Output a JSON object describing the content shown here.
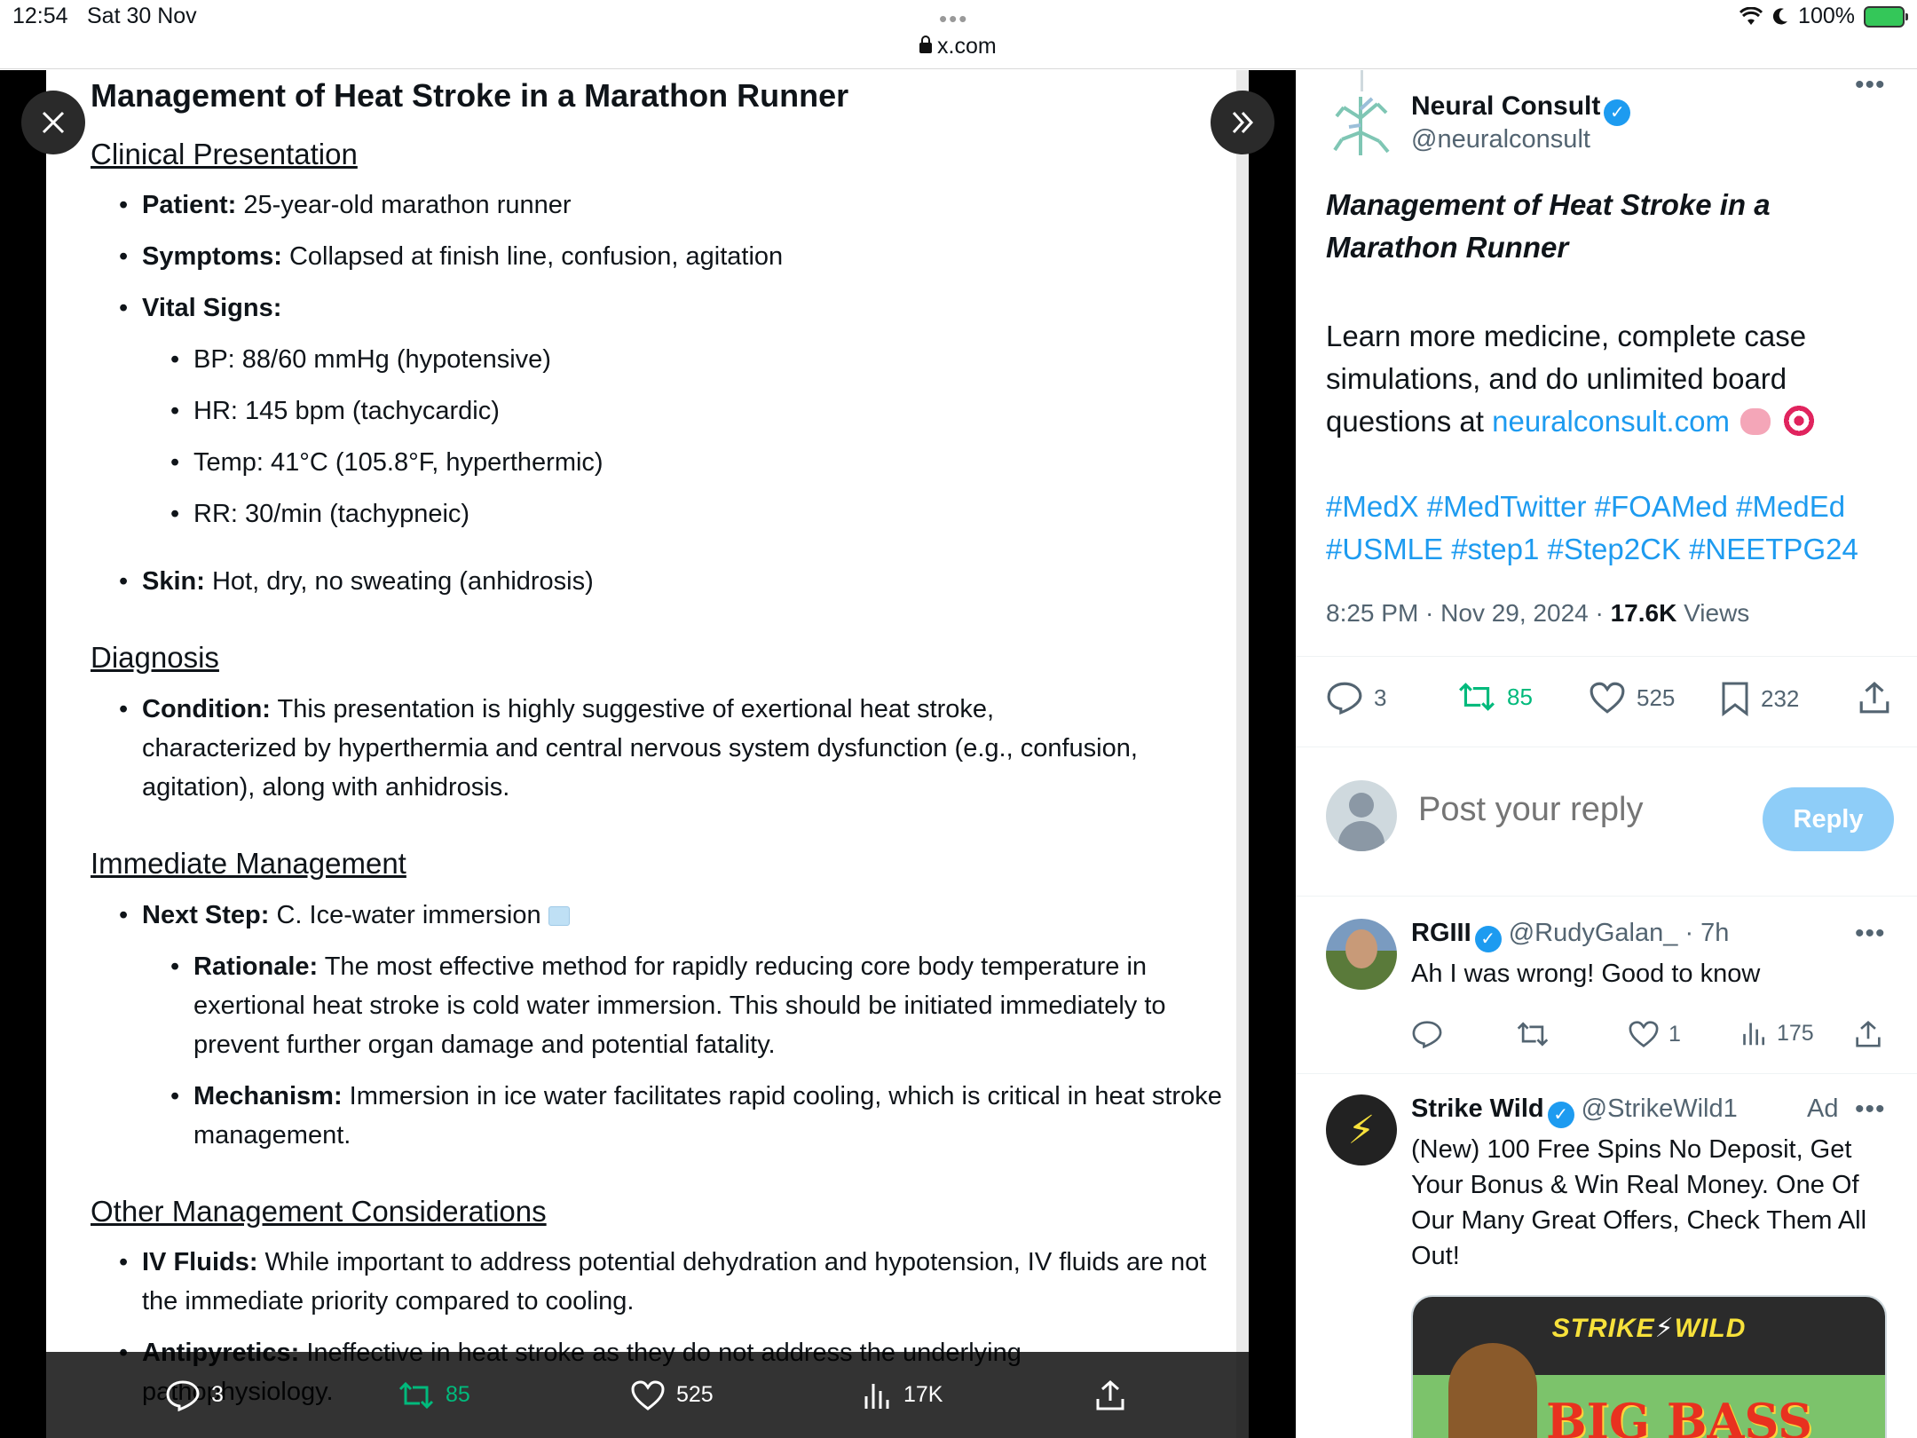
{
  "status_bar": {
    "time": "12:54",
    "date": "Sat 30 Nov",
    "url": "x.com",
    "battery": "100%"
  },
  "document": {
    "title": "Management of Heat Stroke in a Marathon Runner",
    "clinical": {
      "heading": "Clinical Presentation",
      "patient_label": "Patient:",
      "patient_text": " 25-year-old marathon runner",
      "symptoms_label": "Symptoms:",
      "symptoms_text": " Collapsed at finish line, confusion, agitation",
      "vitals_label": "Vital Signs:",
      "vitals": [
        "BP: 88/60 mmHg (hypotensive)",
        "HR: 145 bpm (tachycardic)",
        "Temp: 41°C (105.8°F, hyperthermic)",
        "RR: 30/min (tachypneic)"
      ],
      "skin_label": "Skin:",
      "skin_text": " Hot, dry, no sweating (anhidrosis)"
    },
    "diagnosis": {
      "heading": "Diagnosis",
      "condition_label": "Condition:",
      "condition_text": " This presentation is highly suggestive of exertional heat stroke, characterized by hyperthermia and central nervous system dysfunction (e.g., confusion, agitation), along with anhidrosis."
    },
    "immediate": {
      "heading": "Immediate Management",
      "next_label": "Next Step:",
      "next_text": " C. Ice-water immersion",
      "rationale_label": "Rationale:",
      "rationale_text": " The most effective method for rapidly reducing core body temperature in exertional heat stroke is cold water immersion. This should be initiated immediately to prevent further organ damage and potential fatality.",
      "mechanism_label": "Mechanism:",
      "mechanism_text": " Immersion in ice water facilitates rapid cooling, which is critical in heat stroke management."
    },
    "other": {
      "heading": "Other Management Considerations",
      "iv_label": "IV Fluids:",
      "iv_text": " While important to address potential dehydration and hypotension, IV fluids are not the immediate priority compared to cooling.",
      "anti_label": "Antipyretics:",
      "anti_text": " Ineffective in heat stroke as they do not address the underlying pathophysiology."
    }
  },
  "viewer_bar": {
    "replies": "3",
    "reposts": "85",
    "likes": "525",
    "views": "17K"
  },
  "tweet": {
    "author_name": "Neural Consult",
    "author_handle": "@neuralconsult",
    "title": "Management of Heat Stroke in a Marathon Runner",
    "body_text": "Learn more medicine, complete case simulations, and do unlimited board questions at ",
    "body_link": "neuralconsult.com",
    "hashtags": "#MedX #MedTwitter #FOAMed #MedEd #USMLE #step1 #Step2CK #NEETPG24",
    "timestamp": "8:25 PM · Nov 29, 2024 · ",
    "views_count": "17.6K",
    "views_label": " Views",
    "stats": {
      "replies": "3",
      "reposts": "85",
      "likes": "525",
      "bookmarks": "232"
    }
  },
  "reply_box": {
    "placeholder": "Post your reply",
    "button": "Reply"
  },
  "comments": [
    {
      "name": "RGIII",
      "handle": "@RudyGalan_",
      "time": "7h",
      "text": "Ah I was wrong! Good to know",
      "stats": {
        "likes": "1",
        "views": "175"
      }
    },
    {
      "name": "Strike Wild",
      "handle": "@StrikeWild1",
      "ad_label": "Ad",
      "text": "(New) 100 Free Spins No Deposit, Get Your Bonus & Win Real Money. One Of Our Many Great Offers, Check Them All Out!",
      "card_logo_a": "STRIKE",
      "card_logo_b": "WILD",
      "card_title": "BIG BASS"
    }
  ],
  "colors": {
    "accent": "#1d9bf0",
    "repost": "#00ba7c",
    "reply_button": "#8ecdf8"
  }
}
